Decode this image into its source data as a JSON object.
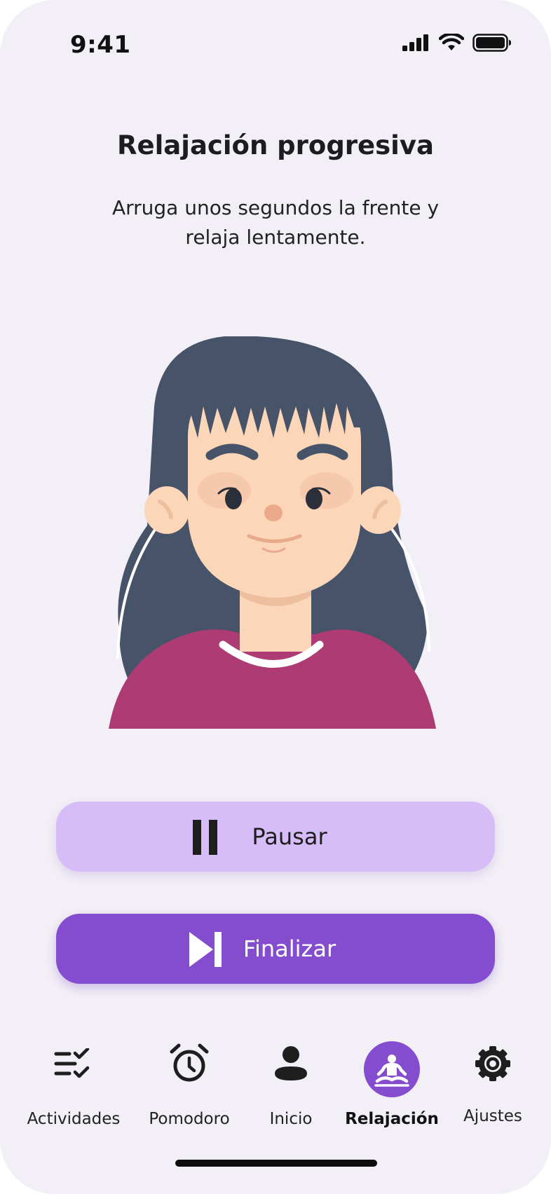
{
  "status_bar": {
    "time": "9:41"
  },
  "screen": {
    "title": "Relajación progresiva",
    "instruction": "Arruga unos segundos la frente y relaja lentamente."
  },
  "buttons": {
    "pause_label": "Pausar",
    "finish_label": "Finalizar"
  },
  "nav": {
    "items": [
      {
        "label": "Actividades",
        "icon": "checklist-icon"
      },
      {
        "label": "Pomodoro",
        "icon": "alarm-clock-icon"
      },
      {
        "label": "Inicio",
        "icon": "person-icon"
      },
      {
        "label": "Relajación",
        "icon": "meditation-icon",
        "active": true
      },
      {
        "label": "Ajustes",
        "icon": "gear-icon"
      }
    ]
  },
  "colors": {
    "background": "#f2eff6",
    "accent": "#844ccf",
    "accent_light": "#d7bdf7",
    "hair": "#465368",
    "skin": "#fbd6b8",
    "shirt": "#ad3c74"
  }
}
